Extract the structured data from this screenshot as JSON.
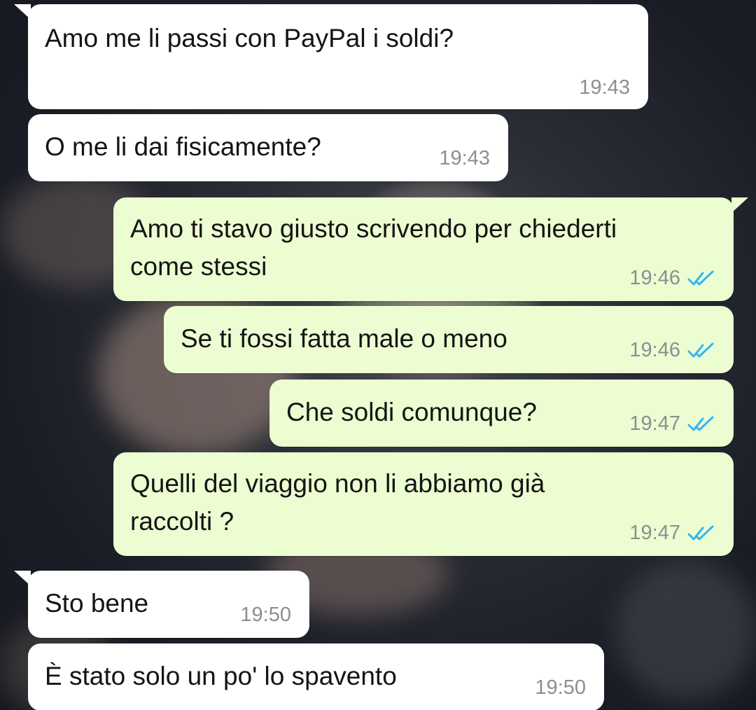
{
  "messages": [
    {
      "text": "Amo me li passi con PayPal i soldi?",
      "time": "19:43",
      "direction": "incoming"
    },
    {
      "text": "O me li dai fisicamente?",
      "time": "19:43",
      "direction": "incoming"
    },
    {
      "text": "Amo ti stavo giusto scrivendo per chiederti\ncome stessi",
      "time": "19:46",
      "direction": "outgoing",
      "status": "read-double-check-icon"
    },
    {
      "text": "Se ti fossi fatta male o meno",
      "time": "19:46",
      "direction": "outgoing",
      "status": "read-double-check-icon"
    },
    {
      "text": "Che soldi comunque?",
      "time": "19:47",
      "direction": "outgoing",
      "status": "read-double-check-icon"
    },
    {
      "text": "Quelli del viaggio non li abbiamo già\nraccolti ?",
      "time": "19:47",
      "direction": "outgoing",
      "status": "read-double-check-icon"
    },
    {
      "text": "Sto bene",
      "time": "19:50",
      "direction": "incoming"
    },
    {
      "text": "È stato solo un po' lo spavento",
      "time": "19:50",
      "direction": "incoming"
    }
  ],
  "colors": {
    "incoming_bubble": "#ffffff",
    "outgoing_bubble": "#ecfdd1",
    "read_tick": "#34b7f1",
    "timestamp": "#8a8f93"
  }
}
